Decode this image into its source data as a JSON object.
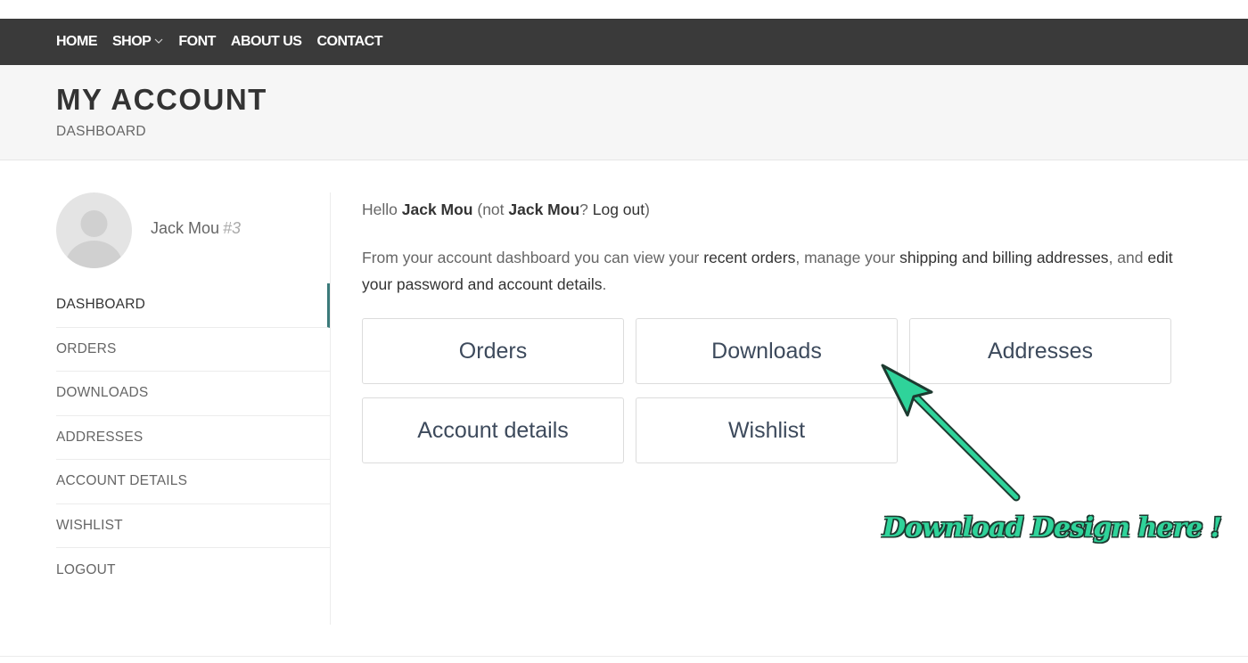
{
  "nav": {
    "items": [
      "HOME",
      "SHOP",
      "FONT",
      "ABOUT US",
      "CONTACT"
    ]
  },
  "header": {
    "title": "MY ACCOUNT",
    "breadcrumb": "DASHBOARD"
  },
  "user": {
    "name": "Jack Mou",
    "id": "#3"
  },
  "sidebar": {
    "items": [
      "DASHBOARD",
      "ORDERS",
      "DOWNLOADS",
      "ADDRESSES",
      "ACCOUNT DETAILS",
      "WISHLIST",
      "LOGOUT"
    ],
    "active": "DASHBOARD"
  },
  "greeting": {
    "hello": "Hello ",
    "name": "Jack Mou",
    "not_prefix": " (not ",
    "not_name": "Jack Mou",
    "q": "? ",
    "logout": "Log out",
    "close": ")"
  },
  "intro": {
    "p1": "From your account dashboard you can view your ",
    "link1": "recent orders",
    "p2": ", manage your ",
    "link2": "shipping and billing addresses",
    "p3": ", and ",
    "link3": "edit your password and account details",
    "p4": "."
  },
  "tiles": [
    "Orders",
    "Downloads",
    "Addresses",
    "Account details",
    "Wishlist"
  ],
  "annotation": {
    "text": "Download Design here !",
    "color": "#2fd39a"
  },
  "colors": {
    "nav_bg": "#3a3a3a",
    "active_border": "#3b7a7a"
  }
}
